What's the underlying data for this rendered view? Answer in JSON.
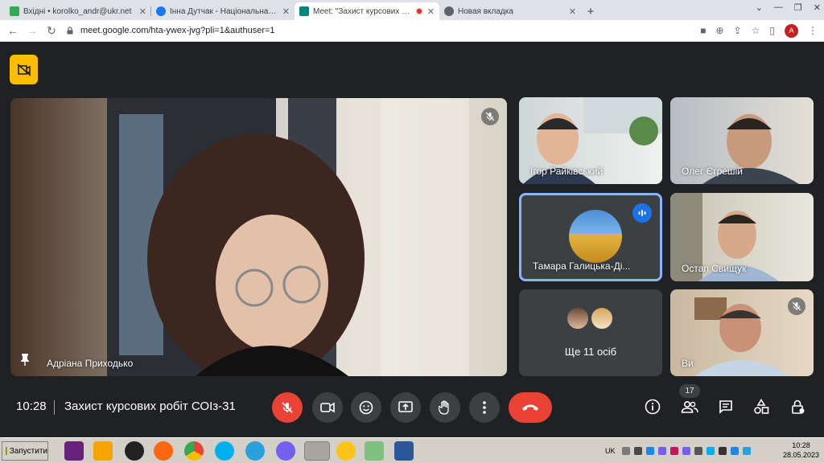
{
  "browser": {
    "tabs": [
      {
        "title": "Вхідні • korolko_andr@ukr.net",
        "color": "#34a853"
      },
      {
        "title": "Інна Дутчак - Національна спіл",
        "color": "#1877f2"
      },
      {
        "title": "Meet: \"Захист курсових робі",
        "color": "#00897b"
      },
      {
        "title": "Новая вкладка",
        "color": "#5f6368"
      }
    ],
    "url": "meet.google.com/hta-ywex-jvg?pli=1&authuser=1",
    "profile_letter": "A"
  },
  "meet": {
    "main_tile": {
      "name": "Адріана Приходько"
    },
    "tiles": [
      {
        "name": "Ігор Райківський"
      },
      {
        "name": "Олег Єгрешій"
      },
      {
        "name": "Тамара Галицька-Ді..."
      },
      {
        "name": "Остап Свищук"
      },
      {
        "name": "Ще 11 осіб"
      },
      {
        "name": "Ви"
      }
    ],
    "time": "10:28",
    "title": "Захист курсових робіт СОІз-31",
    "participants_count": "17"
  },
  "taskbar": {
    "start_label": "Запустити",
    "lang": "UK",
    "clock_time": "10:28",
    "clock_date": "28.05.2023"
  },
  "colors": {
    "accent": "#8ab4f8",
    "danger": "#ea4335",
    "badge": "#fbbc04"
  }
}
